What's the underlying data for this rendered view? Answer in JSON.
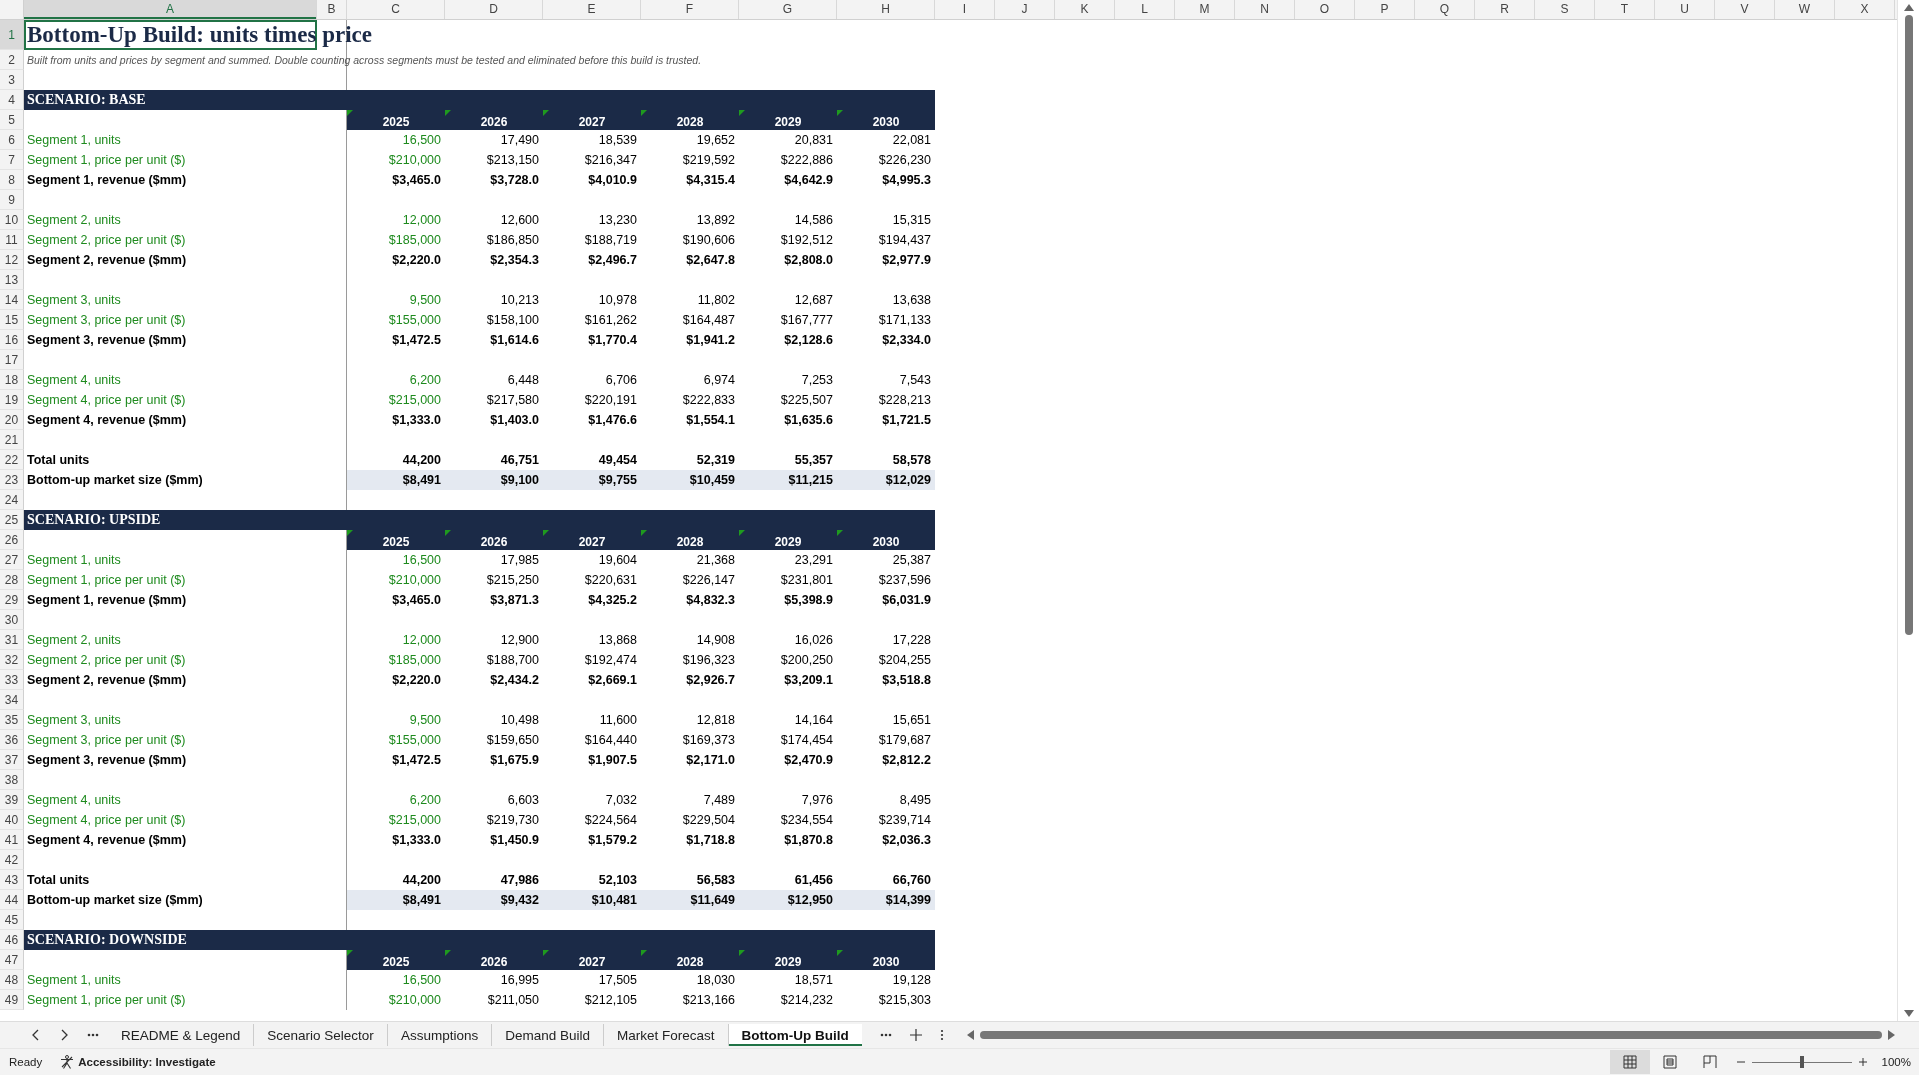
{
  "columns": [
    {
      "label": "A",
      "selected": true
    },
    {
      "label": "B",
      "selected": false
    },
    {
      "label": "C",
      "selected": false
    },
    {
      "label": "D",
      "selected": false
    },
    {
      "label": "E",
      "selected": false
    },
    {
      "label": "F",
      "selected": false
    },
    {
      "label": "G",
      "selected": false
    },
    {
      "label": "H",
      "selected": false
    },
    {
      "label": "I",
      "selected": false
    },
    {
      "label": "J",
      "selected": false
    },
    {
      "label": "K",
      "selected": false
    },
    {
      "label": "L",
      "selected": false
    },
    {
      "label": "M",
      "selected": false
    },
    {
      "label": "N",
      "selected": false
    },
    {
      "label": "O",
      "selected": false
    },
    {
      "label": "P",
      "selected": false
    },
    {
      "label": "Q",
      "selected": false
    },
    {
      "label": "R",
      "selected": false
    },
    {
      "label": "S",
      "selected": false
    },
    {
      "label": "T",
      "selected": false
    },
    {
      "label": "U",
      "selected": false
    },
    {
      "label": "V",
      "selected": false
    },
    {
      "label": "W",
      "selected": false
    },
    {
      "label": "X",
      "selected": false
    }
  ],
  "rows": [
    {
      "number": "1",
      "kind": "title",
      "selected": true,
      "label": "Bottom-Up Build: units times price"
    },
    {
      "number": "2",
      "kind": "subtitle",
      "selected": false,
      "label": "Built from units and prices by segment and summed. Double counting across segments must be tested and eliminated before this build is trusted."
    },
    {
      "number": "3",
      "kind": "blank",
      "selected": false
    },
    {
      "number": "4",
      "kind": "scenario",
      "selected": false,
      "label": "SCENARIO: BASE"
    },
    {
      "number": "5",
      "kind": "years",
      "selected": false,
      "values": [
        "2025",
        "2026",
        "2027",
        "2028",
        "2029",
        "2030"
      ]
    },
    {
      "number": "6",
      "kind": "input",
      "selected": false,
      "label": "Segment 1, units",
      "values": [
        "16,500",
        "17,490",
        "18,539",
        "19,652",
        "20,831",
        "22,081"
      ]
    },
    {
      "number": "7",
      "kind": "input",
      "selected": false,
      "label": "Segment 1, price per unit ($)",
      "values": [
        "$210,000",
        "$213,150",
        "$216,347",
        "$219,592",
        "$222,886",
        "$226,230"
      ]
    },
    {
      "number": "8",
      "kind": "revenue",
      "selected": false,
      "label": "Segment 1, revenue ($mm)",
      "values": [
        "$3,465.0",
        "$3,728.0",
        "$4,010.9",
        "$4,315.4",
        "$4,642.9",
        "$4,995.3"
      ]
    },
    {
      "number": "9",
      "kind": "blank",
      "selected": false
    },
    {
      "number": "10",
      "kind": "input",
      "selected": false,
      "label": "Segment 2, units",
      "values": [
        "12,000",
        "12,600",
        "13,230",
        "13,892",
        "14,586",
        "15,315"
      ]
    },
    {
      "number": "11",
      "kind": "input",
      "selected": false,
      "label": "Segment 2, price per unit ($)",
      "values": [
        "$185,000",
        "$186,850",
        "$188,719",
        "$190,606",
        "$192,512",
        "$194,437"
      ]
    },
    {
      "number": "12",
      "kind": "revenue",
      "selected": false,
      "label": "Segment 2, revenue ($mm)",
      "values": [
        "$2,220.0",
        "$2,354.3",
        "$2,496.7",
        "$2,647.8",
        "$2,808.0",
        "$2,977.9"
      ]
    },
    {
      "number": "13",
      "kind": "blank",
      "selected": false
    },
    {
      "number": "14",
      "kind": "input",
      "selected": false,
      "label": "Segment 3, units",
      "values": [
        "9,500",
        "10,213",
        "10,978",
        "11,802",
        "12,687",
        "13,638"
      ]
    },
    {
      "number": "15",
      "kind": "input",
      "selected": false,
      "label": "Segment 3, price per unit ($)",
      "values": [
        "$155,000",
        "$158,100",
        "$161,262",
        "$164,487",
        "$167,777",
        "$171,133"
      ]
    },
    {
      "number": "16",
      "kind": "revenue",
      "selected": false,
      "label": "Segment 3, revenue ($mm)",
      "values": [
        "$1,472.5",
        "$1,614.6",
        "$1,770.4",
        "$1,941.2",
        "$2,128.6",
        "$2,334.0"
      ]
    },
    {
      "number": "17",
      "kind": "blank",
      "selected": false
    },
    {
      "number": "18",
      "kind": "input",
      "selected": false,
      "label": "Segment 4, units",
      "values": [
        "6,200",
        "6,448",
        "6,706",
        "6,974",
        "7,253",
        "7,543"
      ]
    },
    {
      "number": "19",
      "kind": "input",
      "selected": false,
      "label": "Segment 4, price per unit ($)",
      "values": [
        "$215,000",
        "$217,580",
        "$220,191",
        "$222,833",
        "$225,507",
        "$228,213"
      ]
    },
    {
      "number": "20",
      "kind": "revenue",
      "selected": false,
      "label": "Segment 4, revenue ($mm)",
      "values": [
        "$1,333.0",
        "$1,403.0",
        "$1,476.6",
        "$1,554.1",
        "$1,635.6",
        "$1,721.5"
      ]
    },
    {
      "number": "21",
      "kind": "blank",
      "selected": false
    },
    {
      "number": "22",
      "kind": "total",
      "selected": false,
      "label": "Total units",
      "values": [
        "44,200",
        "46,751",
        "49,454",
        "52,319",
        "55,357",
        "58,578"
      ]
    },
    {
      "number": "23",
      "kind": "market",
      "selected": false,
      "label": "Bottom-up market size ($mm)",
      "values": [
        "$8,491",
        "$9,100",
        "$9,755",
        "$10,459",
        "$11,215",
        "$12,029"
      ]
    },
    {
      "number": "24",
      "kind": "blank",
      "selected": false
    },
    {
      "number": "25",
      "kind": "scenario",
      "selected": false,
      "label": "SCENARIO: UPSIDE"
    },
    {
      "number": "26",
      "kind": "years",
      "selected": false,
      "values": [
        "2025",
        "2026",
        "2027",
        "2028",
        "2029",
        "2030"
      ]
    },
    {
      "number": "27",
      "kind": "input",
      "selected": false,
      "label": "Segment 1, units",
      "values": [
        "16,500",
        "17,985",
        "19,604",
        "21,368",
        "23,291",
        "25,387"
      ]
    },
    {
      "number": "28",
      "kind": "input",
      "selected": false,
      "label": "Segment 1, price per unit ($)",
      "values": [
        "$210,000",
        "$215,250",
        "$220,631",
        "$226,147",
        "$231,801",
        "$237,596"
      ]
    },
    {
      "number": "29",
      "kind": "revenue",
      "selected": false,
      "label": "Segment 1, revenue ($mm)",
      "values": [
        "$3,465.0",
        "$3,871.3",
        "$4,325.2",
        "$4,832.3",
        "$5,398.9",
        "$6,031.9"
      ]
    },
    {
      "number": "30",
      "kind": "blank",
      "selected": false
    },
    {
      "number": "31",
      "kind": "input",
      "selected": false,
      "label": "Segment 2, units",
      "values": [
        "12,000",
        "12,900",
        "13,868",
        "14,908",
        "16,026",
        "17,228"
      ]
    },
    {
      "number": "32",
      "kind": "input",
      "selected": false,
      "label": "Segment 2, price per unit ($)",
      "values": [
        "$185,000",
        "$188,700",
        "$192,474",
        "$196,323",
        "$200,250",
        "$204,255"
      ]
    },
    {
      "number": "33",
      "kind": "revenue",
      "selected": false,
      "label": "Segment 2, revenue ($mm)",
      "values": [
        "$2,220.0",
        "$2,434.2",
        "$2,669.1",
        "$2,926.7",
        "$3,209.1",
        "$3,518.8"
      ]
    },
    {
      "number": "34",
      "kind": "blank",
      "selected": false
    },
    {
      "number": "35",
      "kind": "input",
      "selected": false,
      "label": "Segment 3, units",
      "values": [
        "9,500",
        "10,498",
        "11,600",
        "12,818",
        "14,164",
        "15,651"
      ]
    },
    {
      "number": "36",
      "kind": "input",
      "selected": false,
      "label": "Segment 3, price per unit ($)",
      "values": [
        "$155,000",
        "$159,650",
        "$164,440",
        "$169,373",
        "$174,454",
        "$179,687"
      ]
    },
    {
      "number": "37",
      "kind": "revenue",
      "selected": false,
      "label": "Segment 3, revenue ($mm)",
      "values": [
        "$1,472.5",
        "$1,675.9",
        "$1,907.5",
        "$2,171.0",
        "$2,470.9",
        "$2,812.2"
      ]
    },
    {
      "number": "38",
      "kind": "blank",
      "selected": false
    },
    {
      "number": "39",
      "kind": "input",
      "selected": false,
      "label": "Segment 4, units",
      "values": [
        "6,200",
        "6,603",
        "7,032",
        "7,489",
        "7,976",
        "8,495"
      ]
    },
    {
      "number": "40",
      "kind": "input",
      "selected": false,
      "label": "Segment 4, price per unit ($)",
      "values": [
        "$215,000",
        "$219,730",
        "$224,564",
        "$229,504",
        "$234,554",
        "$239,714"
      ]
    },
    {
      "number": "41",
      "kind": "revenue",
      "selected": false,
      "label": "Segment 4, revenue ($mm)",
      "values": [
        "$1,333.0",
        "$1,450.9",
        "$1,579.2",
        "$1,718.8",
        "$1,870.8",
        "$2,036.3"
      ]
    },
    {
      "number": "42",
      "kind": "blank",
      "selected": false
    },
    {
      "number": "43",
      "kind": "total",
      "selected": false,
      "label": "Total units",
      "values": [
        "44,200",
        "47,986",
        "52,103",
        "56,583",
        "61,456",
        "66,760"
      ]
    },
    {
      "number": "44",
      "kind": "market",
      "selected": false,
      "label": "Bottom-up market size ($mm)",
      "values": [
        "$8,491",
        "$9,432",
        "$10,481",
        "$11,649",
        "$12,950",
        "$14,399"
      ]
    },
    {
      "number": "45",
      "kind": "blank",
      "selected": false
    },
    {
      "number": "46",
      "kind": "scenario",
      "selected": false,
      "label": "SCENARIO: DOWNSIDE"
    },
    {
      "number": "47",
      "kind": "years",
      "selected": false,
      "values": [
        "2025",
        "2026",
        "2027",
        "2028",
        "2029",
        "2030"
      ]
    },
    {
      "number": "48",
      "kind": "input",
      "selected": false,
      "label": "Segment 1, units",
      "values": [
        "16,500",
        "16,995",
        "17,505",
        "18,030",
        "18,571",
        "19,128"
      ]
    },
    {
      "number": "49",
      "kind": "input",
      "selected": false,
      "label": "Segment 1, price per unit ($)",
      "values": [
        "$210,000",
        "$211,050",
        "$212,105",
        "$213,166",
        "$214,232",
        "$215,303"
      ]
    }
  ],
  "sheet_tabs": [
    {
      "label": "README & Legend",
      "selected": false
    },
    {
      "label": "Scenario Selector",
      "selected": false
    },
    {
      "label": "Assumptions",
      "selected": false
    },
    {
      "label": "Demand Build",
      "selected": false
    },
    {
      "label": "Market Forecast",
      "selected": false
    },
    {
      "label": "Bottom-Up Build",
      "selected": true
    }
  ],
  "status_bar": {
    "status": "Ready",
    "accessibility": "Accessibility: Investigate",
    "views": [
      {
        "kind": "normal",
        "selected": true
      },
      {
        "kind": "page_layout",
        "selected": false
      },
      {
        "kind": "page_break",
        "selected": false
      }
    ],
    "zoom": {
      "level": 0.5,
      "reading": "100%"
    }
  }
}
